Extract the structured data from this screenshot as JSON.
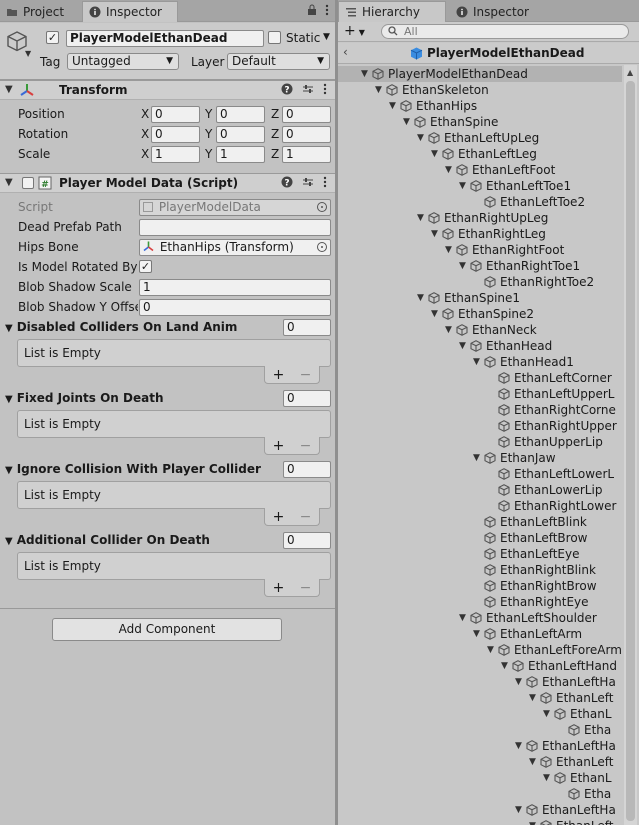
{
  "left_tabs": {
    "project": "Project",
    "inspector": "Inspector"
  },
  "right_tabs": {
    "hierarchy": "Hierarchy",
    "inspector": "Inspector"
  },
  "object": {
    "name": "PlayerModelEthanDead",
    "active": true,
    "static_label": "Static",
    "tag_label": "Tag",
    "tag_value": "Untagged",
    "layer_label": "Layer",
    "layer_value": "Default"
  },
  "transform": {
    "title": "Transform",
    "rows": [
      {
        "label": "Position",
        "x": "0",
        "y": "0",
        "z": "0"
      },
      {
        "label": "Rotation",
        "x": "0",
        "y": "0",
        "z": "0"
      },
      {
        "label": "Scale",
        "x": "1",
        "y": "1",
        "z": "1"
      }
    ],
    "axes": {
      "x": "X",
      "y": "Y",
      "z": "Z"
    }
  },
  "script_component": {
    "title": "Player Model Data (Script)",
    "script_label": "Script",
    "script_value": "PlayerModelData",
    "dead_prefab_label": "Dead Prefab Path",
    "dead_prefab_value": "",
    "hips_label": "Hips Bone",
    "hips_value": "EthanHips (Transform)",
    "rotated_label": "Is Model Rotated By 9",
    "rotated_checked": "✓",
    "blob_scale_label": "Blob Shadow Scale",
    "blob_scale_value": "1",
    "blob_offset_label": "Blob Shadow Y Offse",
    "blob_offset_value": "0",
    "lists": [
      {
        "title": "Disabled Colliders On Land Anim",
        "count": "0",
        "empty": "List is Empty"
      },
      {
        "title": "Fixed Joints On Death",
        "count": "0",
        "empty": "List is Empty"
      },
      {
        "title": "Ignore Collision With Player Collider",
        "count": "0",
        "empty": "List is Empty"
      },
      {
        "title": "Additional Collider On Death",
        "count": "0",
        "empty": "List is Empty"
      }
    ],
    "plus": "+",
    "minus": "−"
  },
  "add_component": "Add Component",
  "hierarchy": {
    "search_placeholder": "All",
    "breadcrumb": "PlayerModelEthanDead",
    "add_button": "+",
    "items": [
      {
        "label": "PlayerModelEthanDead",
        "depth": 0,
        "fold": true,
        "selected": true
      },
      {
        "label": "EthanSkeleton",
        "depth": 1,
        "fold": true
      },
      {
        "label": "EthanHips",
        "depth": 2,
        "fold": true
      },
      {
        "label": "EthanSpine",
        "depth": 3,
        "fold": true
      },
      {
        "label": "EthanLeftUpLeg",
        "depth": 4,
        "fold": true
      },
      {
        "label": "EthanLeftLeg",
        "depth": 5,
        "fold": true
      },
      {
        "label": "EthanLeftFoot",
        "depth": 6,
        "fold": true
      },
      {
        "label": "EthanLeftToe1",
        "depth": 7,
        "fold": true
      },
      {
        "label": "EthanLeftToe2",
        "depth": 8,
        "fold": false
      },
      {
        "label": "EthanRightUpLeg",
        "depth": 4,
        "fold": true
      },
      {
        "label": "EthanRightLeg",
        "depth": 5,
        "fold": true
      },
      {
        "label": "EthanRightFoot",
        "depth": 6,
        "fold": true
      },
      {
        "label": "EthanRightToe1",
        "depth": 7,
        "fold": true
      },
      {
        "label": "EthanRightToe2",
        "depth": 8,
        "fold": false
      },
      {
        "label": "EthanSpine1",
        "depth": 4,
        "fold": true
      },
      {
        "label": "EthanSpine2",
        "depth": 5,
        "fold": true
      },
      {
        "label": "EthanNeck",
        "depth": 6,
        "fold": true
      },
      {
        "label": "EthanHead",
        "depth": 7,
        "fold": true
      },
      {
        "label": "EthanHead1",
        "depth": 8,
        "fold": true
      },
      {
        "label": "EthanLeftCorner",
        "depth": 9,
        "fold": false
      },
      {
        "label": "EthanLeftUpperL",
        "depth": 9,
        "fold": false
      },
      {
        "label": "EthanRightCorne",
        "depth": 9,
        "fold": false
      },
      {
        "label": "EthanRightUpper",
        "depth": 9,
        "fold": false
      },
      {
        "label": "EthanUpperLip",
        "depth": 9,
        "fold": false
      },
      {
        "label": "EthanJaw",
        "depth": 8,
        "fold": true
      },
      {
        "label": "EthanLeftLowerL",
        "depth": 9,
        "fold": false
      },
      {
        "label": "EthanLowerLip",
        "depth": 9,
        "fold": false
      },
      {
        "label": "EthanRightLower",
        "depth": 9,
        "fold": false
      },
      {
        "label": "EthanLeftBlink",
        "depth": 8,
        "fold": false
      },
      {
        "label": "EthanLeftBrow",
        "depth": 8,
        "fold": false
      },
      {
        "label": "EthanLeftEye",
        "depth": 8,
        "fold": false
      },
      {
        "label": "EthanRightBlink",
        "depth": 8,
        "fold": false
      },
      {
        "label": "EthanRightBrow",
        "depth": 8,
        "fold": false
      },
      {
        "label": "EthanRightEye",
        "depth": 8,
        "fold": false
      },
      {
        "label": "EthanLeftShoulder",
        "depth": 7,
        "fold": true
      },
      {
        "label": "EthanLeftArm",
        "depth": 8,
        "fold": true
      },
      {
        "label": "EthanLeftForeArm",
        "depth": 9,
        "fold": true
      },
      {
        "label": "EthanLeftHand",
        "depth": 10,
        "fold": true
      },
      {
        "label": "EthanLeftHa",
        "depth": 11,
        "fold": true
      },
      {
        "label": "EthanLeft",
        "depth": 12,
        "fold": true
      },
      {
        "label": "EthanL",
        "depth": 13,
        "fold": true
      },
      {
        "label": "Etha",
        "depth": 14,
        "fold": false
      },
      {
        "label": "EthanLeftHa",
        "depth": 11,
        "fold": true
      },
      {
        "label": "EthanLeft",
        "depth": 12,
        "fold": true
      },
      {
        "label": "EthanL",
        "depth": 13,
        "fold": true
      },
      {
        "label": "Etha",
        "depth": 14,
        "fold": false
      },
      {
        "label": "EthanLeftHa",
        "depth": 11,
        "fold": true
      },
      {
        "label": "EthanLeft",
        "depth": 12,
        "fold": true
      }
    ]
  }
}
